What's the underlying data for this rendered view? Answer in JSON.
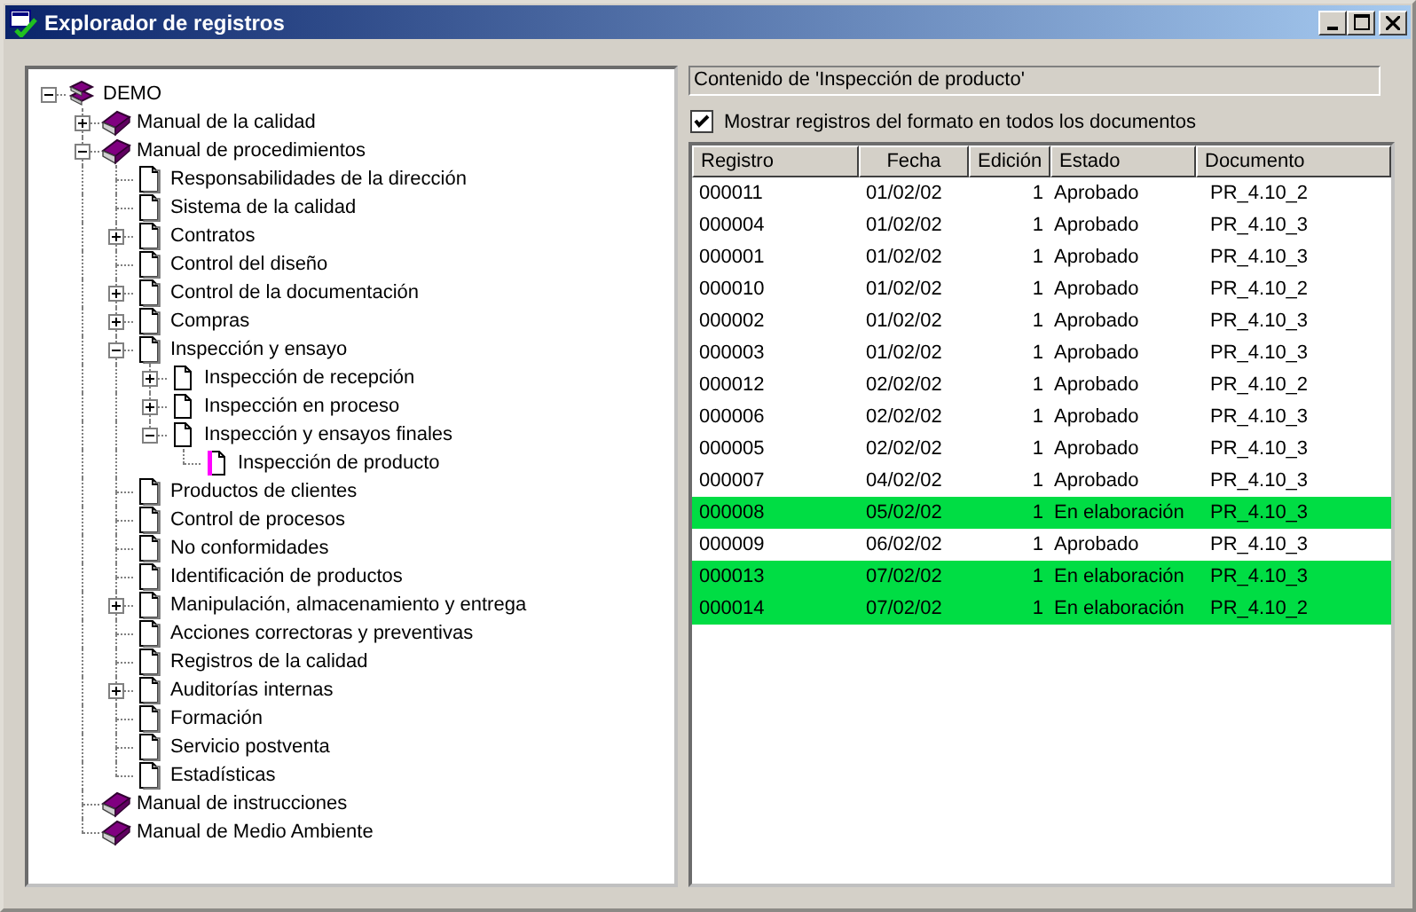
{
  "window": {
    "title": "Explorador de registros"
  },
  "tree": [
    {
      "label": "DEMO",
      "kind": "library",
      "expanded": true,
      "children": [
        {
          "label": "Manual de la calidad",
          "kind": "book",
          "expanded": false
        },
        {
          "label": "Manual de procedimientos",
          "kind": "book",
          "expanded": true,
          "children": [
            {
              "label": "Responsabilidades de la dirección",
              "kind": "document"
            },
            {
              "label": "Sistema de la calidad",
              "kind": "document"
            },
            {
              "label": "Contratos",
              "kind": "document",
              "expanded": false
            },
            {
              "label": "Control del diseño",
              "kind": "document"
            },
            {
              "label": "Control de la documentación",
              "kind": "document",
              "expanded": false
            },
            {
              "label": "Compras",
              "kind": "document",
              "expanded": false
            },
            {
              "label": "Inspección y ensayo",
              "kind": "document",
              "expanded": true,
              "children": [
                {
                  "label": "Inspección de recepción",
                  "kind": "page",
                  "expanded": false
                },
                {
                  "label": "Inspección en proceso",
                  "kind": "page",
                  "expanded": false
                },
                {
                  "label": "Inspección y ensayos finales",
                  "kind": "page",
                  "expanded": true,
                  "children": [
                    {
                      "label": "Inspección de producto",
                      "kind": "form"
                    }
                  ]
                }
              ]
            },
            {
              "label": "Productos de clientes",
              "kind": "document"
            },
            {
              "label": "Control de procesos",
              "kind": "document"
            },
            {
              "label": "No conformidades",
              "kind": "document"
            },
            {
              "label": "Identificación de productos",
              "kind": "document"
            },
            {
              "label": "Manipulación, almacenamiento y entrega",
              "kind": "document",
              "expanded": false
            },
            {
              "label": "Acciones correctoras y preventivas",
              "kind": "document"
            },
            {
              "label": "Registros de la calidad",
              "kind": "document"
            },
            {
              "label": "Auditorías internas",
              "kind": "document",
              "expanded": false
            },
            {
              "label": "Formación",
              "kind": "document"
            },
            {
              "label": "Servicio postventa",
              "kind": "document"
            },
            {
              "label": "Estadísticas",
              "kind": "document"
            }
          ]
        },
        {
          "label": "Manual de instrucciones",
          "kind": "book"
        },
        {
          "label": "Manual de Medio Ambiente",
          "kind": "book"
        }
      ]
    }
  ],
  "content_label": "Contenido de 'Inspección de producto'",
  "show_all": {
    "label": "Mostrar registros del formato en todos los documentos",
    "checked": true
  },
  "table": {
    "columns": [
      "Registro",
      "Fecha",
      "Edición",
      "Estado",
      "Documento"
    ],
    "rows": [
      {
        "cells": [
          "000011",
          "01/02/02",
          "1",
          "Aprobado",
          "PR_4.10_2"
        ],
        "color": "#ffffff"
      },
      {
        "cells": [
          "000004",
          "01/02/02",
          "1",
          "Aprobado",
          "PR_4.10_3"
        ],
        "color": "#ffffff"
      },
      {
        "cells": [
          "000001",
          "01/02/02",
          "1",
          "Aprobado",
          "PR_4.10_3"
        ],
        "color": "#ffffff"
      },
      {
        "cells": [
          "000010",
          "01/02/02",
          "1",
          "Aprobado",
          "PR_4.10_2"
        ],
        "color": "#ffffff"
      },
      {
        "cells": [
          "000002",
          "01/02/02",
          "1",
          "Aprobado",
          "PR_4.10_3"
        ],
        "color": "#ffffff"
      },
      {
        "cells": [
          "000003",
          "01/02/02",
          "1",
          "Aprobado",
          "PR_4.10_3"
        ],
        "color": "#ffffff"
      },
      {
        "cells": [
          "000012",
          "02/02/02",
          "1",
          "Aprobado",
          "PR_4.10_2"
        ],
        "color": "#ffffff"
      },
      {
        "cells": [
          "000006",
          "02/02/02",
          "1",
          "Aprobado",
          "PR_4.10_3"
        ],
        "color": "#ffffff"
      },
      {
        "cells": [
          "000005",
          "02/02/02",
          "1",
          "Aprobado",
          "PR_4.10_3"
        ],
        "color": "#ffffff"
      },
      {
        "cells": [
          "000007",
          "04/02/02",
          "1",
          "Aprobado",
          "PR_4.10_3"
        ],
        "color": "#ffffff"
      },
      {
        "cells": [
          "000008",
          "05/02/02",
          "1",
          "En elaboración",
          "PR_4.10_3"
        ],
        "color": "#00dd44"
      },
      {
        "cells": [
          "000009",
          "06/02/02",
          "1",
          "Aprobado",
          "PR_4.10_3"
        ],
        "color": "#ffffff"
      },
      {
        "cells": [
          "000013",
          "07/02/02",
          "1",
          "En elaboración",
          "PR_4.10_3"
        ],
        "color": "#00dd44"
      },
      {
        "cells": [
          "000014",
          "07/02/02",
          "1",
          "En elaboración",
          "PR_4.10_2"
        ],
        "color": "#00dd44"
      }
    ]
  }
}
